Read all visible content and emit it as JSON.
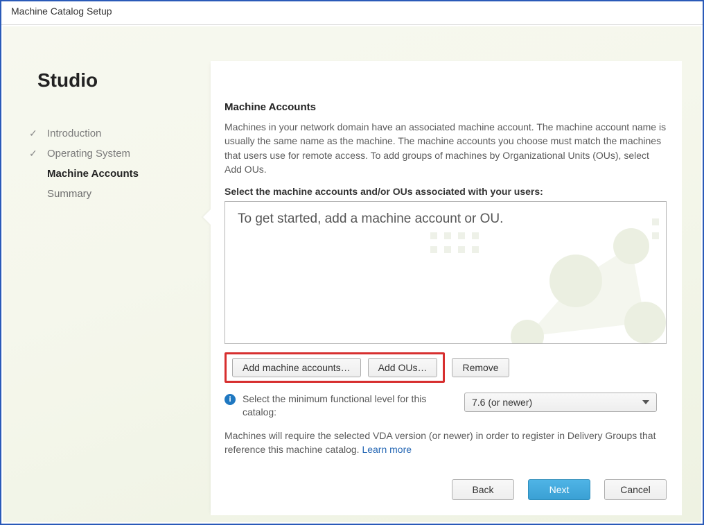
{
  "window": {
    "title": "Machine Catalog Setup"
  },
  "sidebar": {
    "brand": "Studio",
    "items": [
      {
        "label": "Introduction",
        "state": "done"
      },
      {
        "label": "Operating System",
        "state": "done"
      },
      {
        "label": "Machine Accounts",
        "state": "active"
      },
      {
        "label": "Summary",
        "state": "upcoming"
      }
    ]
  },
  "main": {
    "heading": "Machine Accounts",
    "description": "Machines in your network domain have an associated machine account. The machine account name is usually the same name as the machine. The machine accounts you choose must match the machines that users use for remote access. To add groups of machines by Organizational Units (OUs), select Add OUs.",
    "subheading": "Select the machine accounts and/or OUs associated with your users:",
    "listbox_placeholder": "To get started, add a machine account or OU.",
    "buttons": {
      "add_accounts": "Add machine accounts…",
      "add_ous": "Add OUs…",
      "remove": "Remove"
    },
    "functional": {
      "label": "Select the minimum functional level for this catalog:",
      "selected": "7.6 (or newer)"
    },
    "note_prefix": "Machines will require the selected VDA version (or newer) in order to register in Delivery Groups that reference this machine catalog. ",
    "note_link": "Learn more"
  },
  "wizard": {
    "back": "Back",
    "next": "Next",
    "cancel": "Cancel"
  }
}
